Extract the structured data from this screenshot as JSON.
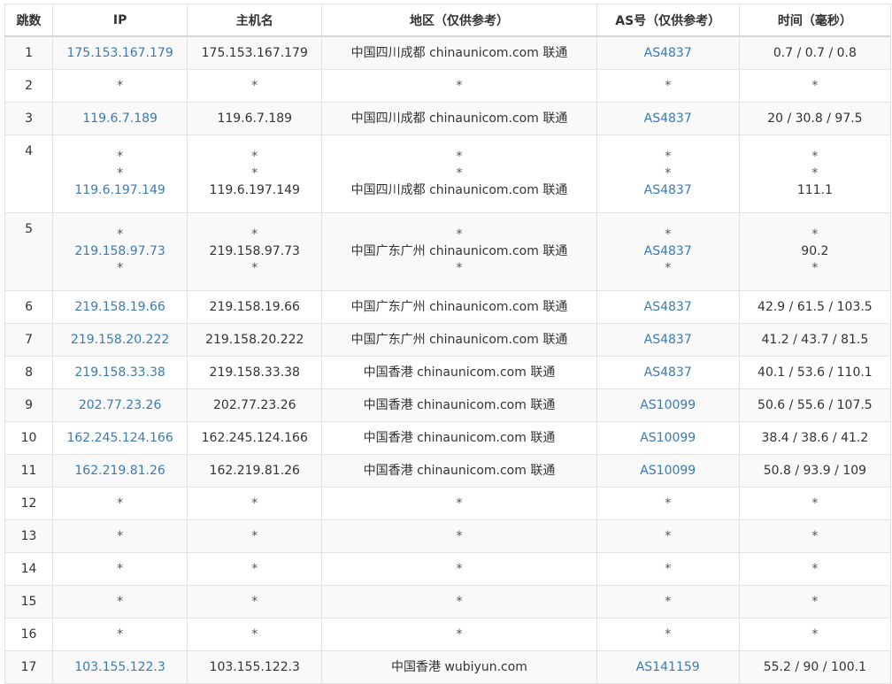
{
  "table": {
    "headers": {
      "hop": "跳数",
      "ip": "IP",
      "host": "主机名",
      "region": "地区（仅供参考）",
      "as": "AS号（仅供参考）",
      "time": "时间（毫秒）"
    },
    "rows": [
      {
        "hop": "1",
        "lines": [
          {
            "ip": "175.153.167.179",
            "host": "175.153.167.179",
            "region": "中国四川成都 chinaunicom.com 联通",
            "as": "AS4837"
          }
        ],
        "time": [
          "0.7 / 0.7 / 0.8"
        ]
      },
      {
        "hop": "2",
        "lines": [
          {
            "ip": "*",
            "host": "*",
            "region": "*",
            "as": "*"
          }
        ],
        "time": [
          "*"
        ]
      },
      {
        "hop": "3",
        "lines": [
          {
            "ip": "119.6.7.189",
            "host": "119.6.7.189",
            "region": "中国四川成都 chinaunicom.com 联通",
            "as": "AS4837"
          }
        ],
        "time": [
          "20 / 30.8 / 97.5"
        ]
      },
      {
        "hop": "4",
        "lines": [
          {
            "ip": "*",
            "host": "*",
            "region": "*",
            "as": "*"
          },
          {
            "ip": "*",
            "host": "*",
            "region": "*",
            "as": "*"
          },
          {
            "ip": "119.6.197.149",
            "host": "119.6.197.149",
            "region": "中国四川成都 chinaunicom.com 联通",
            "as": "AS4837"
          }
        ],
        "time": [
          "*",
          "*",
          "111.1"
        ]
      },
      {
        "hop": "5",
        "lines": [
          {
            "ip": "*",
            "host": "*",
            "region": "*",
            "as": "*"
          },
          {
            "ip": "219.158.97.73",
            "host": "219.158.97.73",
            "region": "中国广东广州 chinaunicom.com 联通",
            "as": "AS4837"
          },
          {
            "ip": "*",
            "host": "*",
            "region": "*",
            "as": "*"
          }
        ],
        "time": [
          "*",
          "90.2",
          "*"
        ]
      },
      {
        "hop": "6",
        "lines": [
          {
            "ip": "219.158.19.66",
            "host": "219.158.19.66",
            "region": "中国广东广州 chinaunicom.com 联通",
            "as": "AS4837"
          }
        ],
        "time": [
          "42.9 / 61.5 / 103.5"
        ]
      },
      {
        "hop": "7",
        "lines": [
          {
            "ip": "219.158.20.222",
            "host": "219.158.20.222",
            "region": "中国广东广州 chinaunicom.com 联通",
            "as": "AS4837"
          }
        ],
        "time": [
          "41.2 / 43.7 / 81.5"
        ]
      },
      {
        "hop": "8",
        "lines": [
          {
            "ip": "219.158.33.38",
            "host": "219.158.33.38",
            "region": "中国香港 chinaunicom.com 联通",
            "as": "AS4837"
          }
        ],
        "time": [
          "40.1 / 53.6 / 110.1"
        ]
      },
      {
        "hop": "9",
        "lines": [
          {
            "ip": "202.77.23.26",
            "host": "202.77.23.26",
            "region": "中国香港 chinaunicom.com 联通",
            "as": "AS10099"
          }
        ],
        "time": [
          "50.6 / 55.6 / 107.5"
        ]
      },
      {
        "hop": "10",
        "lines": [
          {
            "ip": "162.245.124.166",
            "host": "162.245.124.166",
            "region": "中国香港 chinaunicom.com 联通",
            "as": "AS10099"
          }
        ],
        "time": [
          "38.4 / 38.6 / 41.2"
        ]
      },
      {
        "hop": "11",
        "lines": [
          {
            "ip": "162.219.81.26",
            "host": "162.219.81.26",
            "region": "中国香港 chinaunicom.com 联通",
            "as": "AS10099"
          }
        ],
        "time": [
          "50.8 / 93.9 / 109"
        ]
      },
      {
        "hop": "12",
        "lines": [
          {
            "ip": "*",
            "host": "*",
            "region": "*",
            "as": "*"
          }
        ],
        "time": [
          "*"
        ]
      },
      {
        "hop": "13",
        "lines": [
          {
            "ip": "*",
            "host": "*",
            "region": "*",
            "as": "*"
          }
        ],
        "time": [
          "*"
        ]
      },
      {
        "hop": "14",
        "lines": [
          {
            "ip": "*",
            "host": "*",
            "region": "*",
            "as": "*"
          }
        ],
        "time": [
          "*"
        ]
      },
      {
        "hop": "15",
        "lines": [
          {
            "ip": "*",
            "host": "*",
            "region": "*",
            "as": "*"
          }
        ],
        "time": [
          "*"
        ]
      },
      {
        "hop": "16",
        "lines": [
          {
            "ip": "*",
            "host": "*",
            "region": "*",
            "as": "*"
          }
        ],
        "time": [
          "*"
        ]
      },
      {
        "hop": "17",
        "lines": [
          {
            "ip": "103.155.122.3",
            "host": "103.155.122.3",
            "region": "中国香港 wubiyun.com",
            "as": "AS141159"
          }
        ],
        "time": [
          "55.2 / 90 / 100.1"
        ]
      }
    ]
  },
  "colors": {
    "link": "#3a7bb5",
    "stripe": "#f9f9f9",
    "border": "#e2e2e2",
    "text": "#333333"
  }
}
